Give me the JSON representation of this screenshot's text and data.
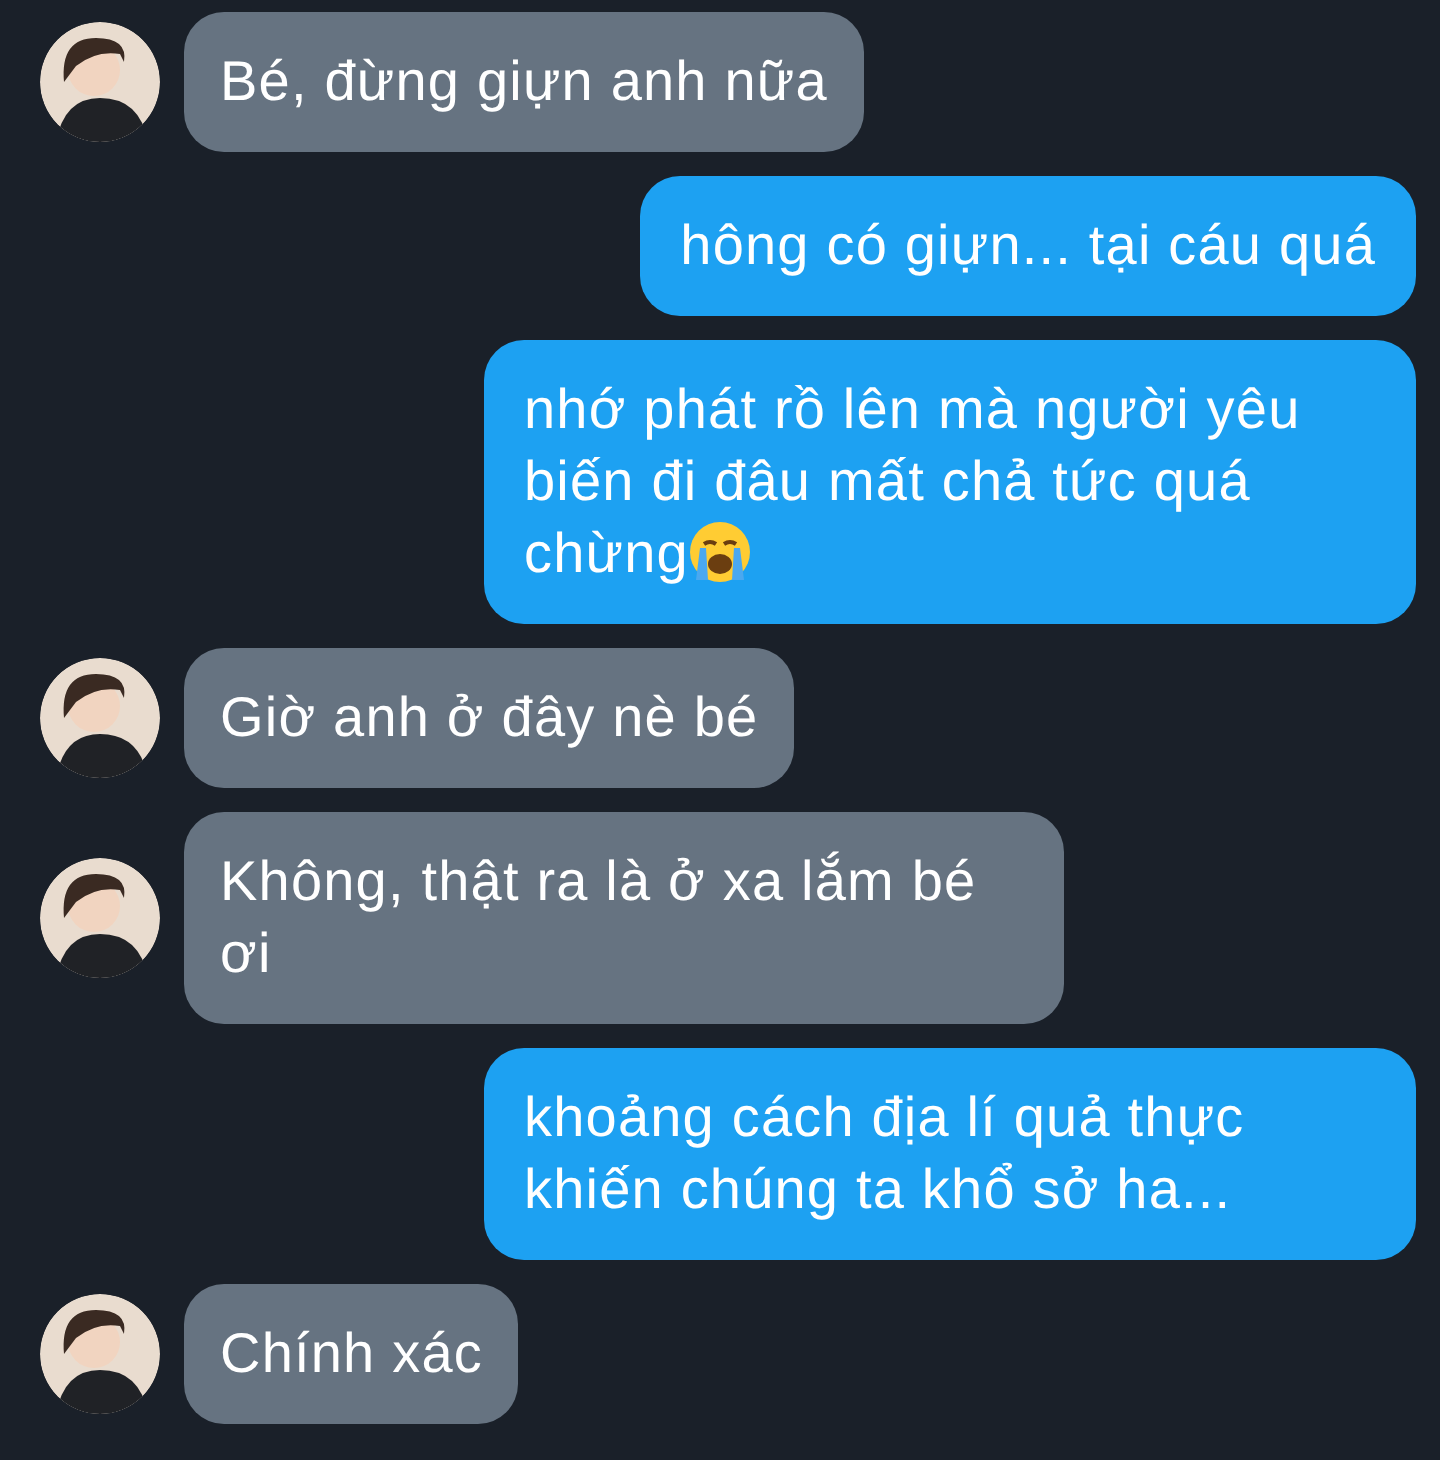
{
  "messages": [
    {
      "kind": "incoming",
      "text": "Bé, đừng giựn anh nữa"
    },
    {
      "kind": "outgoing",
      "text": "hông có giựn... tại cáu quá"
    },
    {
      "kind": "outgoing",
      "text": "nhớ phát rồ lên mà người yêu biến đi đâu mất chả tức quá chừng",
      "emoji": true
    },
    {
      "kind": "incoming",
      "text": "Giờ anh ở đây nè bé"
    },
    {
      "kind": "incoming",
      "text": "Không, thật ra là ở xa lắm bé ơi"
    },
    {
      "kind": "outgoing",
      "text": "khoảng cách địa lí quả thực khiến chúng ta khổ sở ha..."
    },
    {
      "kind": "incoming",
      "text": "Chính xác"
    }
  ]
}
